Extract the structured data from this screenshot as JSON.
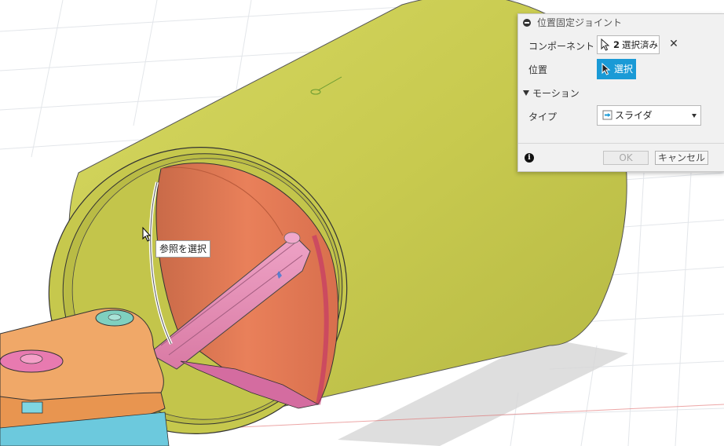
{
  "tooltip": {
    "text": "参照を選択"
  },
  "dialog": {
    "title": "位置固定ジョイント",
    "component_label": "コンポーネント",
    "component_count": "2",
    "component_selected": "選択済み",
    "position_label": "位置",
    "position_button": "選択",
    "motion_section": "モーション",
    "type_label": "タイプ",
    "type_value": "スライダ",
    "ok_label": "OK",
    "cancel_label": "キャンセル"
  },
  "icons": [
    "collapse-icon",
    "cursor-icon",
    "close-icon",
    "slider-type-icon",
    "dropdown-caret-icon",
    "info-icon",
    "mouse-pointer-icon"
  ],
  "colors": {
    "cylinder": "#c7c94e",
    "inner_bore": "#e07a55",
    "rod": "#e48bb3",
    "base_part": "#f0a868",
    "accent": "#1a9ad6"
  }
}
